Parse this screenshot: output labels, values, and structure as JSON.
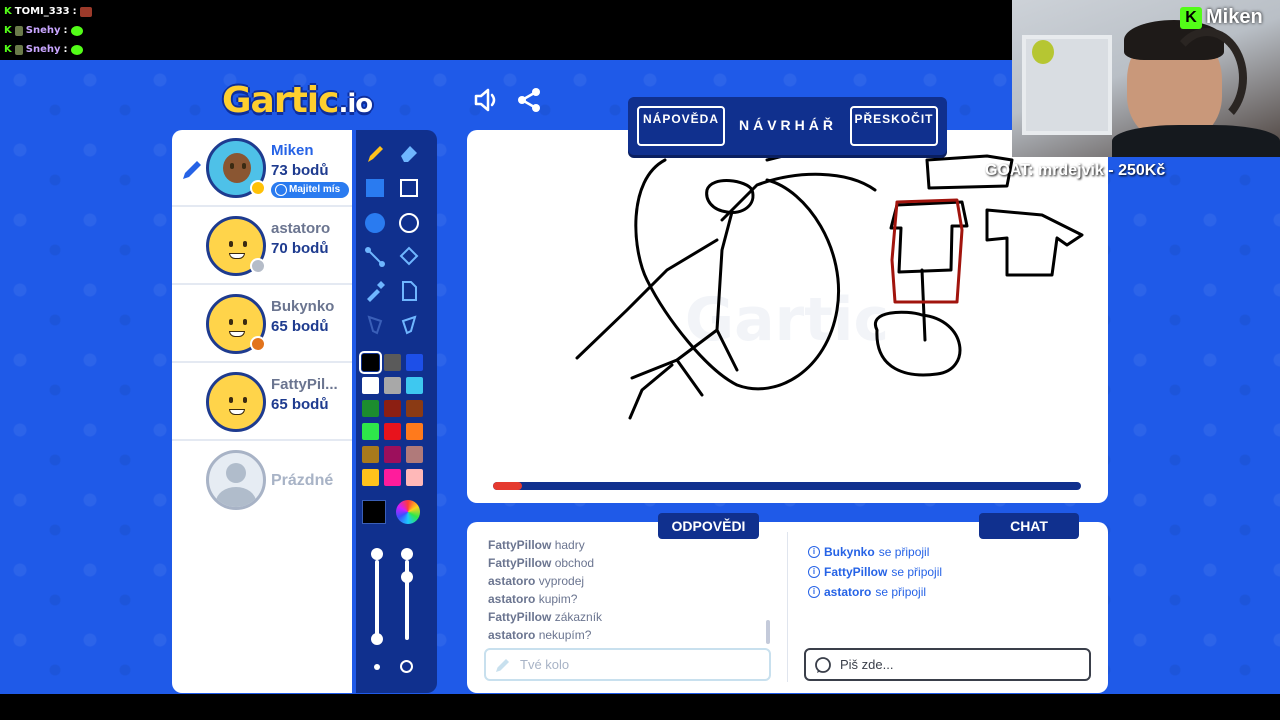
{
  "stream_chat": [
    {
      "user": "TOMI_333",
      "sep": ":"
    },
    {
      "user": "Snehy",
      "sep": ":"
    },
    {
      "user": "Snehy",
      "sep": ":"
    }
  ],
  "logo": {
    "main": "Gartic",
    "suffix": ".io"
  },
  "players": [
    {
      "name": "Miken",
      "points": "73 bodů",
      "badge": "Majitel mís",
      "active": true,
      "dot_color": "#ffc107"
    },
    {
      "name": "astatoro",
      "points": "70 bodů",
      "dot_color": "#b5bcc8"
    },
    {
      "name": "Bukynko",
      "points": "65 bodů",
      "dot_color": "#e2731c"
    },
    {
      "name": "FattyPil...",
      "points": "65 bodů"
    },
    {
      "name": "Prázdné",
      "points": ""
    }
  ],
  "palette": [
    "#000000",
    "#5a5a5a",
    "#1d4fe8",
    "#ffffff",
    "#a8a8a8",
    "#3ec8f0",
    "#1c8c2e",
    "#8c1f12",
    "#8a3a14",
    "#2ee84a",
    "#e8131c",
    "#ff7a1c",
    "#a87a1c",
    "#9c0f5c",
    "#b07a7a",
    "#ffc21c",
    "#ff1c9c",
    "#ffb8b8"
  ],
  "selected_color": "#000000",
  "hint": {
    "help_label": "NÁPOVĚDA",
    "word": "NÁVRHÁŘ",
    "skip_label": "PŘESKOČIT"
  },
  "timer_progress": 0.05,
  "tabs": {
    "answers": "ODPOVĚDI",
    "chat": "CHAT"
  },
  "answers": [
    {
      "user": "FattyPillow",
      "text": "hadry"
    },
    {
      "user": "FattyPillow",
      "text": "obchod"
    },
    {
      "user": "astatoro",
      "text": "vyprodej"
    },
    {
      "user": "astatoro",
      "text": "kupim?"
    },
    {
      "user": "FattyPillow",
      "text": "zákazník"
    },
    {
      "user": "astatoro",
      "text": "nekupím?"
    }
  ],
  "chat": [
    {
      "user": "Bukynko",
      "text": "se připojil"
    },
    {
      "user": "FattyPillow",
      "text": "se připojil"
    },
    {
      "user": "astatoro",
      "text": "se připojil"
    }
  ],
  "answer_input": {
    "placeholder": "Tvé kolo"
  },
  "chat_input": {
    "placeholder": "Piš zde..."
  },
  "streamer": {
    "name": "Miken",
    "goal": "GOAT: mrdejvik - 250Kč"
  }
}
